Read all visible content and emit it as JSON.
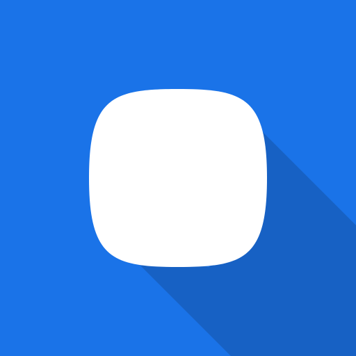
{
  "icon": {
    "name": "squircle-app-icon",
    "colors": {
      "background": "#1a73e8",
      "shape": "#ffffff",
      "long_shadow": "#1557b0"
    }
  }
}
